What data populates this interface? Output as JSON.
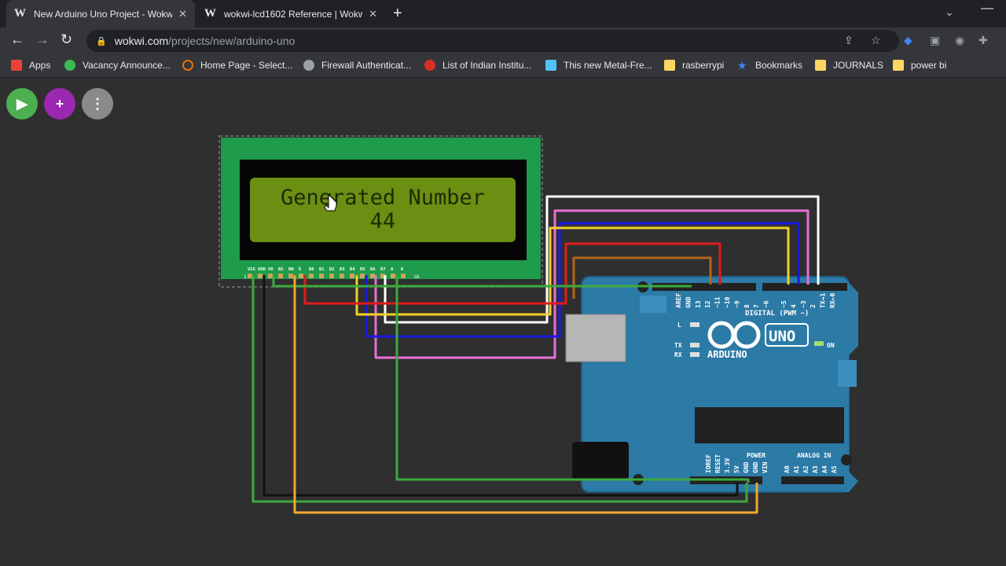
{
  "tabs": [
    {
      "favicon": "W",
      "title": "New Arduino Uno Project - Wokwi",
      "active": true
    },
    {
      "favicon": "W",
      "title": "wokwi-lcd1602 Reference | Wokwi",
      "active": false
    }
  ],
  "address_bar": {
    "host": "wokwi.com",
    "path": "/projects/new/arduino-uno"
  },
  "bookmarks": [
    {
      "label": "Apps",
      "icon": "apps-grid-icon",
      "color": "#ea4335"
    },
    {
      "label": "Vacancy Announce...",
      "icon": "leaf-icon",
      "color": "#3cba54"
    },
    {
      "label": "Home Page - Select...",
      "icon": "arc-icon",
      "color": "#e8710a"
    },
    {
      "label": "Firewall Authenticat...",
      "icon": "globe-icon",
      "color": "#9aa0a6"
    },
    {
      "label": "List of Indian Institu...",
      "icon": "red-c-icon",
      "color": "#d93025"
    },
    {
      "label": "This new Metal-Fre...",
      "icon": "page-icon",
      "color": "#4fc3f7"
    },
    {
      "label": "rasberrypi",
      "icon": "folder-icon",
      "color": "#fdd663"
    },
    {
      "label": "Bookmarks",
      "icon": "star-icon",
      "color": "#4285f4"
    },
    {
      "label": "JOURNALS",
      "icon": "folder-icon",
      "color": "#fdd663"
    },
    {
      "label": "power bi",
      "icon": "folder-icon",
      "color": "#fdd663"
    }
  ],
  "fabs": {
    "run": {
      "glyph": "▶",
      "color": "#4caf50"
    },
    "add": {
      "glyph": "+",
      "color": "#9c27b0"
    },
    "more": {
      "glyph": "⋮",
      "color": "#8a8a8a"
    }
  },
  "lcd": {
    "line1": "Generated Number",
    "line2": "44",
    "pins": [
      "VSS",
      "VDD",
      "V0",
      "RS",
      "RW",
      "E",
      "D0",
      "D1",
      "D2",
      "D3",
      "D4",
      "D5",
      "D6",
      "D7",
      "A",
      "K"
    ],
    "pin_first": "1",
    "pin_last": "16"
  },
  "arduino": {
    "brand": "ARDUINO",
    "model": "UNO",
    "digital_label": "DIGITAL (PWM ~)",
    "digital_pins": [
      "AREF",
      "GND",
      "13",
      "12",
      "~11",
      "~10",
      "~9",
      "8",
      "7",
      "~6",
      "~5",
      "4",
      "~3",
      "2",
      "TX→1",
      "RX←0"
    ],
    "leds": [
      "L",
      "TX",
      "RX"
    ],
    "on_label": "ON",
    "power_label": "POWER",
    "power_pins": [
      "IOREF",
      "RESET",
      "3.3V",
      "5V",
      "GND",
      "GND",
      "VIN"
    ],
    "analog_label": "ANALOG IN",
    "analog_pins": [
      "A0",
      "A1",
      "A2",
      "A3",
      "A4",
      "A5"
    ]
  },
  "colors": {
    "board_blue": "#2c7aa6",
    "lcd_green": "#1e9b4b",
    "screen_green": "#6b8f12",
    "wire_white": "#ffffff",
    "wire_pink": "#e86fd6",
    "wire_blue": "#1a1ae0",
    "wire_yellow": "#f2d027",
    "wire_red": "#e01b1b",
    "wire_brown": "#b5651d",
    "wire_green": "#3caa3c",
    "wire_orange": "#f0a830",
    "wire_black": "#111111"
  }
}
